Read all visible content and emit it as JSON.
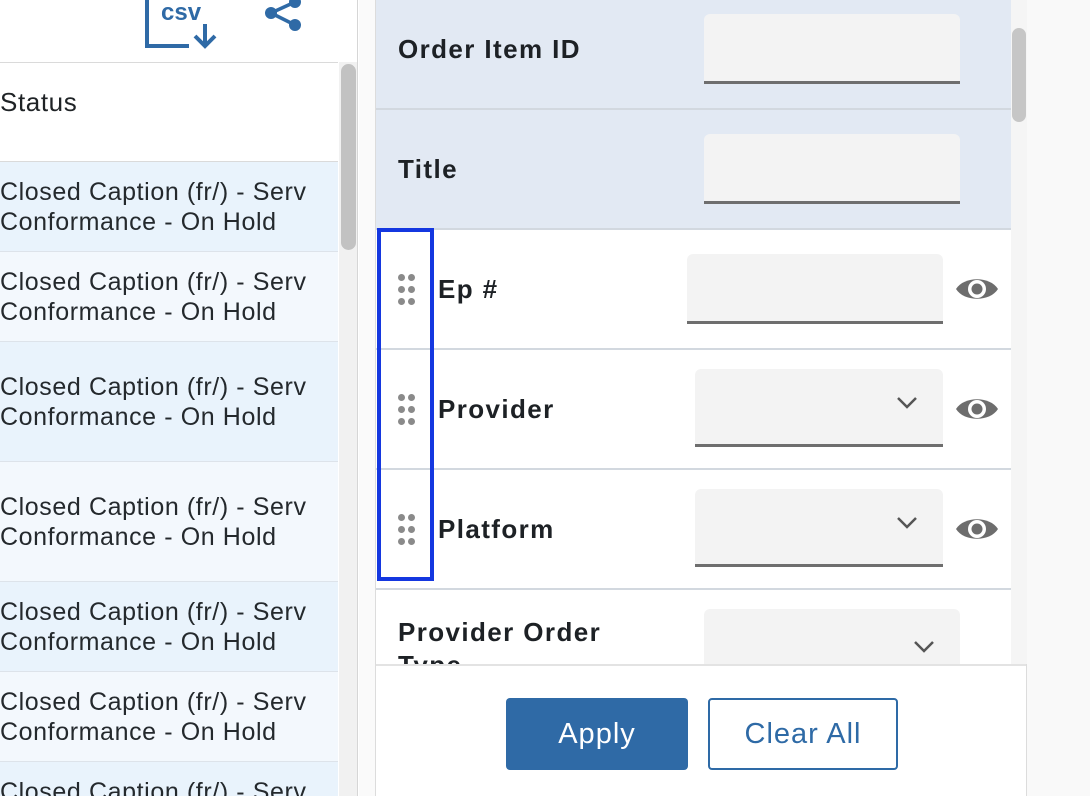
{
  "toolbar": {
    "csv_icon_text": "csv"
  },
  "table": {
    "column_header": "Status",
    "rows": [
      {
        "line1": "Closed Caption (fr/) - Serv",
        "line2": "Conformance - On Hold"
      },
      {
        "line1": "Closed Caption (fr/) - Serv",
        "line2": "Conformance - On Hold"
      },
      {
        "line1": "Closed Caption (fr/) - Serv",
        "line2": "Conformance - On Hold"
      },
      {
        "line1": "Closed Caption (fr/) - Serv",
        "line2": "Conformance - On Hold"
      },
      {
        "line1": "Closed Caption (fr/) - Serv",
        "line2": "Conformance - On Hold"
      },
      {
        "line1": "Closed Caption (fr/) - Serv",
        "line2": "Conformance - On Hold"
      },
      {
        "line1": "Closed Caption (fr/) - Serv",
        "line2": ""
      }
    ]
  },
  "filters": {
    "pinned": [
      {
        "label": "Order Item ID",
        "value": ""
      },
      {
        "label": "Title",
        "value": ""
      }
    ],
    "movable": [
      {
        "label": "Ep #",
        "type": "text",
        "value": ""
      },
      {
        "label": "Provider",
        "type": "select",
        "value": ""
      },
      {
        "label": "Platform",
        "type": "select",
        "value": ""
      }
    ],
    "extra": [
      {
        "label": "Provider Order Type",
        "type": "select",
        "value": ""
      }
    ]
  },
  "footer": {
    "apply_label": "Apply",
    "clear_label": "Clear All"
  },
  "colors": {
    "accent": "#2f6aa6",
    "highlight": "#1437e0",
    "pinned_row_bg": "#e2e9f3"
  }
}
